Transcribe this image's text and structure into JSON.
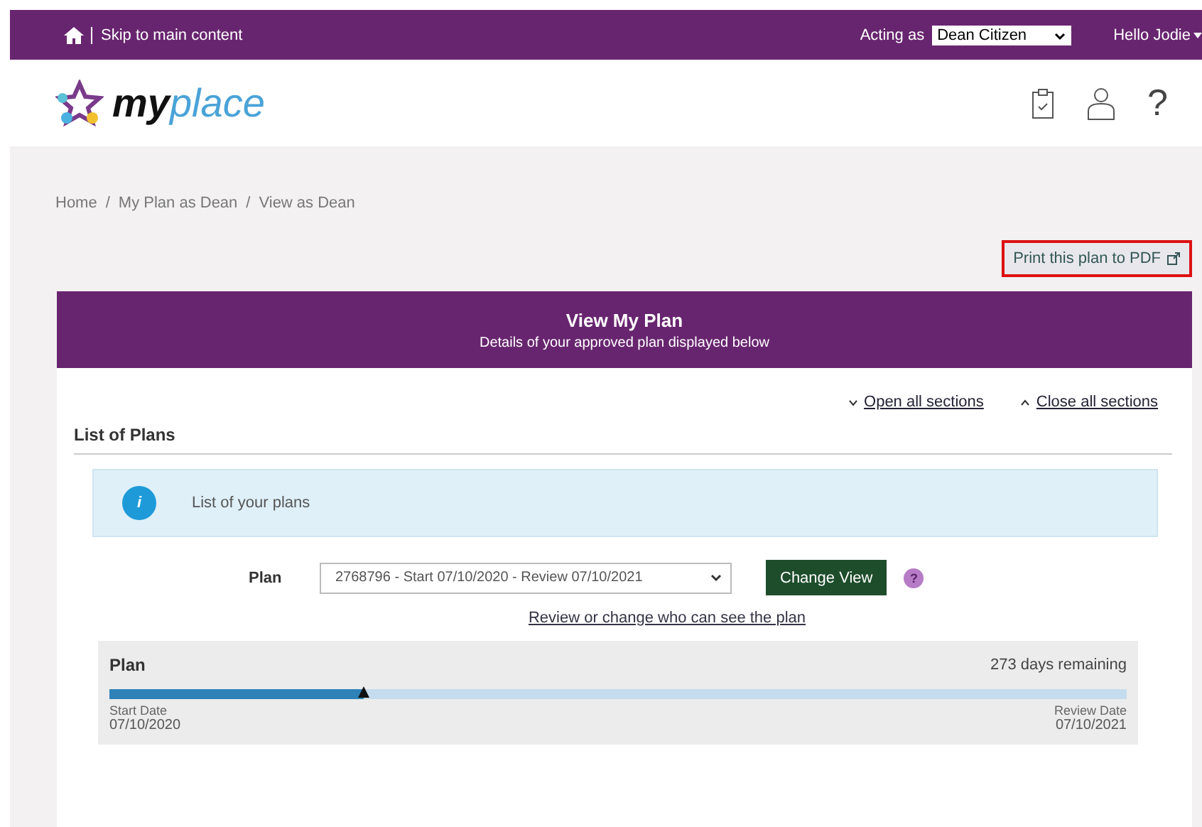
{
  "top_bar": {
    "skip_link": "Skip to main content",
    "acting_as_label": "Acting as",
    "acting_as_value": "Dean Citizen",
    "greeting": "Hello Jodie"
  },
  "logo": {
    "part_1": "my",
    "part_2": "place"
  },
  "breadcrumbs": [
    "Home",
    "My Plan as Dean",
    "View as Dean"
  ],
  "breadcrumb_separator": "/",
  "header_help": "?",
  "print_button": "Print this plan to PDF",
  "banner": {
    "title": "View My Plan",
    "subtitle": "Details of your approved plan displayed below"
  },
  "section_links": [
    {
      "label": "Open all sections",
      "kind": "open"
    },
    {
      "label": "Close all sections",
      "kind": "close"
    }
  ],
  "section_title": "List of Plans",
  "info": {
    "icon": "i",
    "text": "List of your plans"
  },
  "plan_select": {
    "label": "Plan",
    "value": "2768796 - Start 07/10/2020 - Review 07/10/2021",
    "button": "Change View",
    "help": "?"
  },
  "visibility_link": "Review or change who can see the plan",
  "plan": {
    "title": "Plan",
    "remaining": "273 days remaining",
    "level": 0.25,
    "start_label": "Start Date",
    "start_date": "07/10/2020",
    "review_label": "Review Date",
    "review_date": "07/10/2021"
  }
}
